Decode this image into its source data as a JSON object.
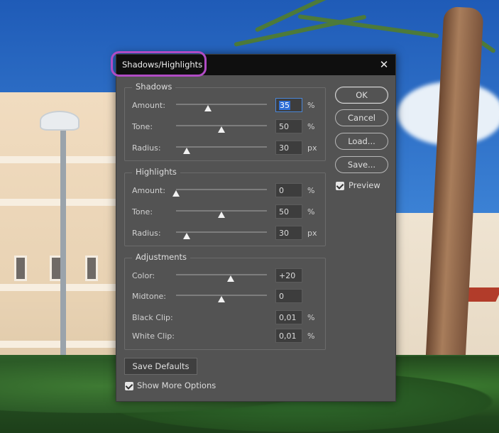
{
  "dialog": {
    "title": "Shadows/Highlights",
    "close_icon": "close-icon"
  },
  "shadows": {
    "title": "Shadows",
    "rows": [
      {
        "label": "Amount:",
        "value": "35",
        "unit": "%",
        "level": 0.35,
        "focused": true
      },
      {
        "label": "Tone:",
        "value": "50",
        "unit": "%",
        "level": 0.5
      },
      {
        "label": "Radius:",
        "value": "30",
        "unit": "px",
        "level": 0.12
      }
    ]
  },
  "highlights": {
    "title": "Highlights",
    "rows": [
      {
        "label": "Amount:",
        "value": "0",
        "unit": "%",
        "level": 0.0
      },
      {
        "label": "Tone:",
        "value": "50",
        "unit": "%",
        "level": 0.5
      },
      {
        "label": "Radius:",
        "value": "30",
        "unit": "px",
        "level": 0.12
      }
    ]
  },
  "adjustments": {
    "title": "Adjustments",
    "rows": [
      {
        "label": "Color:",
        "value": "+20",
        "unit": "",
        "level": 0.6
      },
      {
        "label": "Midtone:",
        "value": "0",
        "unit": "",
        "level": 0.5
      },
      {
        "label": "Black Clip:",
        "value": "0,01",
        "unit": "%"
      },
      {
        "label": "White Clip:",
        "value": "0,01",
        "unit": "%"
      }
    ]
  },
  "buttons": {
    "ok": "OK",
    "cancel": "Cancel",
    "load": "Load...",
    "save": "Save...",
    "save_defaults": "Save Defaults"
  },
  "options": {
    "preview_label": "Preview",
    "preview_checked": true,
    "show_more_label": "Show More Options",
    "show_more_checked": true
  },
  "colors": {
    "dialog_bg": "#535353",
    "title_bar": "#0f0f0f",
    "highlight_ring": "#b04cc4",
    "focus_blue": "#2f6fd6"
  }
}
